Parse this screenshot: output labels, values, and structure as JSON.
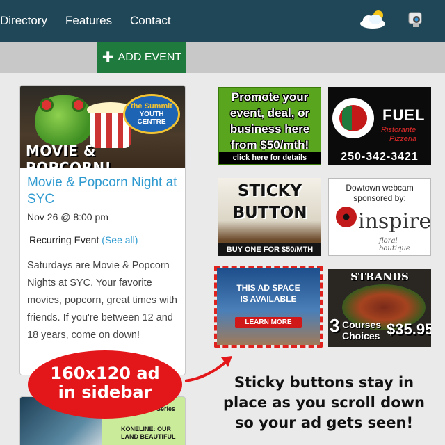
{
  "nav": {
    "links": [
      "Directory",
      "Features",
      "Contact"
    ],
    "icons": [
      "weather-icon",
      "webcam-icon"
    ]
  },
  "add_event": {
    "plus": "✚",
    "label": "ADD EVENT"
  },
  "event_card": {
    "image_title": "MOVIE & POPCORN!",
    "logo_lines": [
      "the Summit",
      "YOUTH",
      "CENTRE"
    ],
    "title": "Movie & Popcorn Night at SYC",
    "date": "Nov 26 @ 8:00 pm",
    "recurring": "Recurring Event",
    "see_all": "(See all)",
    "description": "Saturdays are Movie & Popcorn Nights at SYC. Your favorite movies, popcorn, great times with friends. If you're between 12 and 18 years, come on down!"
  },
  "event_card_2": {
    "series": "Series",
    "text": "KONELINE: OUR LAND BEAUTIFUL"
  },
  "ads": {
    "promote": {
      "text": "Promote your event, deal, or business here from $50/mth!",
      "strip": "click here for details"
    },
    "fuel": {
      "name": "FUEL",
      "sub1": "Ristorante",
      "sub2": "Pizzeria",
      "phone": "250-342-3421"
    },
    "sticky": {
      "title1": "STICKY",
      "title2": "BUTTON",
      "strip": "BUY ONE FOR $50/MTH"
    },
    "inspire": {
      "caption1": "Dowtown webcam",
      "caption2": "sponsored by:",
      "brand": "inspire",
      "sub": "floral boutique"
    },
    "available": {
      "line1": "THIS AD SPACE",
      "line2": "IS AVAILABLE",
      "button": "LEARN MORE"
    },
    "strands": {
      "name": "STRANDS",
      "num": "3",
      "courses": "Courses",
      "choices": "Choices",
      "price": "$35.95"
    }
  },
  "callouts": {
    "oval_line1": "160x120 ad",
    "oval_line2": "in sidebar",
    "sticky_line1": "Sticky buttons stay in",
    "sticky_line2": "place as you scroll down",
    "sticky_line3": "so your ad gets seen!"
  },
  "colors": {
    "nav_bg": "#1f4757",
    "add_event_bg": "#1f7a3d",
    "link_blue": "#2e9ad0",
    "callout_red": "#e3161a"
  }
}
